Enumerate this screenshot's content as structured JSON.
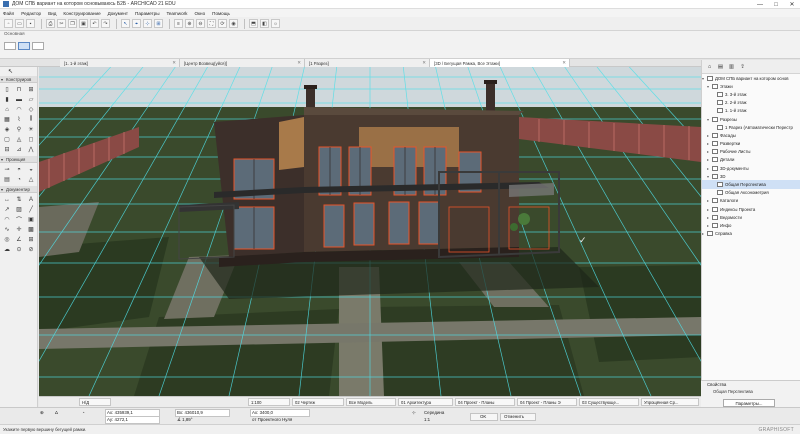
{
  "window": {
    "title": "ДОМ СПБ вариант на котором основываюсь Б2Б - ARCHICAD 21 EDU",
    "controls": [
      "—",
      "□",
      "✕"
    ]
  },
  "menu": [
    "Файл",
    "Редактор",
    "Вид",
    "Конструирование",
    "Документ",
    "Параметры",
    "Teamwork",
    "Окно",
    "Помощь"
  ],
  "subbar": {
    "label": "Основная"
  },
  "tabs": [
    {
      "label": "[1. 1-й этаж]"
    },
    {
      "label": "[Центр Возвещ(уйся)]"
    },
    {
      "label": "[1 Разрез]"
    },
    {
      "label": "[3D / Бегущая Рамка, Все Этажи]"
    }
  ],
  "left_panel": {
    "sections": [
      {
        "label": "Конструиров"
      },
      {
        "label": "Проекция"
      },
      {
        "label": "Документир"
      }
    ],
    "arrow_icon": "↖"
  },
  "navigator": {
    "root": "ДОМ СПБ вариант на котором основ",
    "items": [
      {
        "label": "Этажи",
        "level": 1
      },
      {
        "label": "3. 3-й этаж",
        "level": 2
      },
      {
        "label": "2. 2-й этаж",
        "level": 2
      },
      {
        "label": "1. 1-й этаж",
        "level": 2
      },
      {
        "label": "Разрезы",
        "level": 1
      },
      {
        "label": "1 Разрез (Автоматически Перестр",
        "level": 2
      },
      {
        "label": "Фасады",
        "level": 1
      },
      {
        "label": "Развертки",
        "level": 1
      },
      {
        "label": "Рабочие Листы",
        "level": 1
      },
      {
        "label": "Детали",
        "level": 1
      },
      {
        "label": "3D-документы",
        "level": 1
      },
      {
        "label": "3D",
        "level": 1
      },
      {
        "label": "Общая Перспектива",
        "level": 2,
        "selected": true
      },
      {
        "label": "Общая Аксонометрия",
        "level": 2
      },
      {
        "label": "Каталоги",
        "level": 1
      },
      {
        "label": "Индексы Проекта",
        "level": 1
      },
      {
        "label": "Ведомости",
        "level": 1
      },
      {
        "label": "Инфо",
        "level": 1
      },
      {
        "label": "Справка",
        "level": 0
      }
    ]
  },
  "properties": {
    "header": "Свойства",
    "value": "Общая Перспектива",
    "button": "Параметры..."
  },
  "quick_options": [
    "Н/Д",
    "1:100",
    "02 Чертеж",
    "Все Модель",
    "01 Архитектура",
    "04 Проект - Планы",
    "04 Проект - Планы Э",
    "03 Существующе...",
    "Упрощённая Ср..."
  ],
  "info_box": {
    "ax": "Ах: 435939,1",
    "ay": "Ау: 4272,1",
    "bx": "Вх: 436010,9",
    "angle": "∡ 1,89°",
    "z": "Ах: 3400,0",
    "from": "от Проектного Нуля",
    "measure": "Середина",
    "scale_label": "1:1",
    "ok": "OK",
    "cancel": "Отменить"
  },
  "status": {
    "text": "Укажите первую вершину бегущей рамки.",
    "brand": "GRAPHISOFT"
  },
  "colors": {
    "grid": "#4fe0e8",
    "lawn": "#2d3a22",
    "paving": "#6b6b5a",
    "wall_dark": "#3c2f2a",
    "frame_orange": "#e8542a",
    "wood": "#a87a4a",
    "selection": "#cfe0f5"
  }
}
